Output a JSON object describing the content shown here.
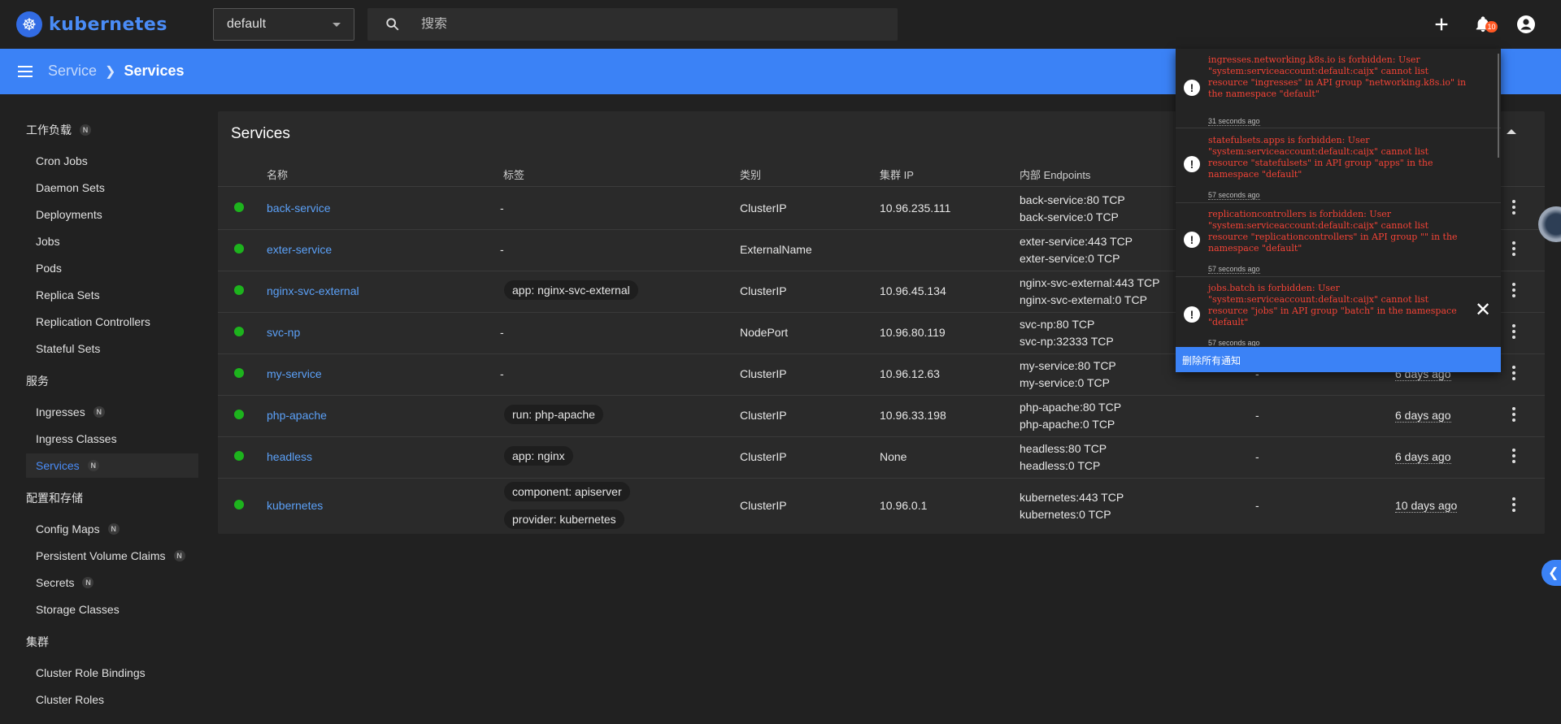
{
  "app": {
    "name": "kubernetes"
  },
  "namespace": {
    "selected": "default"
  },
  "search": {
    "placeholder": "搜索"
  },
  "notifications": {
    "count": "10",
    "clear_label": "删除所有通知",
    "items": [
      {
        "message": "ingresses.networking.k8s.io is forbidden: User \"system:serviceaccount:default:caijx\" cannot list resource \"ingresses\" in API group \"networking.k8s.io\" in the namespace \"default\"",
        "time": "31 seconds ago"
      },
      {
        "message": "statefulsets.apps is forbidden: User \"system:serviceaccount:default:caijx\" cannot list resource \"statefulsets\" in API group \"apps\" in the namespace \"default\"",
        "time": "57 seconds ago"
      },
      {
        "message": "replicationcontrollers is forbidden: User \"system:serviceaccount:default:caijx\" cannot list resource \"replicationcontrollers\" in API group \"\" in the namespace \"default\"",
        "time": "57 seconds ago"
      },
      {
        "message": "jobs.batch is forbidden: User \"system:serviceaccount:default:caijx\" cannot list resource \"jobs\" in API group \"batch\" in the namespace \"default\"",
        "time": "57 seconds ago"
      }
    ]
  },
  "breadcrumb": {
    "parent": "Service",
    "current": "Services"
  },
  "sidebar": {
    "workloads": {
      "title": "工作负载",
      "badge": "N",
      "items": [
        "Cron Jobs",
        "Daemon Sets",
        "Deployments",
        "Jobs",
        "Pods",
        "Replica Sets",
        "Replication Controllers",
        "Stateful Sets"
      ]
    },
    "service": {
      "title": "服务",
      "items": [
        {
          "label": "Ingresses",
          "badge": "N"
        },
        {
          "label": "Ingress Classes"
        },
        {
          "label": "Services",
          "badge": "N",
          "active": true
        }
      ]
    },
    "config": {
      "title": "配置和存储",
      "items": [
        {
          "label": "Config Maps",
          "badge": "N"
        },
        {
          "label": "Persistent Volume Claims",
          "badge": "N"
        },
        {
          "label": "Secrets",
          "badge": "N"
        },
        {
          "label": "Storage Classes"
        }
      ]
    },
    "cluster": {
      "title": "集群",
      "items": [
        "Cluster Role Bindings",
        "Cluster Roles"
      ]
    }
  },
  "table": {
    "title": "Services",
    "columns": {
      "name": "名称",
      "labels": "标签",
      "type": "类别",
      "cluster_ip": "集群 IP",
      "endpoints": "内部 Endpoints"
    },
    "rows": [
      {
        "name": "back-service",
        "labels": [
          "-"
        ],
        "type": "ClusterIP",
        "cluster_ip": "10.96.235.111",
        "endpoints": [
          "back-service:80 TCP",
          "back-service:0 TCP"
        ],
        "external": "",
        "age": ""
      },
      {
        "name": "exter-service",
        "labels": [
          "-"
        ],
        "type": "ExternalName",
        "cluster_ip": "",
        "endpoints": [
          "exter-service:443 TCP",
          "exter-service:0 TCP"
        ],
        "external": "",
        "age": ""
      },
      {
        "name": "nginx-svc-external",
        "labels": [
          "app: nginx-svc-external"
        ],
        "type": "ClusterIP",
        "cluster_ip": "10.96.45.134",
        "endpoints": [
          "nginx-svc-external:443 TCP",
          "nginx-svc-external:0 TCP"
        ],
        "external": "",
        "age": ""
      },
      {
        "name": "svc-np",
        "labels": [
          "-"
        ],
        "type": "NodePort",
        "cluster_ip": "10.96.80.119",
        "endpoints": [
          "svc-np:80 TCP",
          "svc-np:32333 TCP"
        ],
        "external": "",
        "age": ""
      },
      {
        "name": "my-service",
        "labels": [
          "-"
        ],
        "type": "ClusterIP",
        "cluster_ip": "10.96.12.63",
        "endpoints": [
          "my-service:80 TCP",
          "my-service:0 TCP"
        ],
        "external": "-",
        "age": "6 days ago"
      },
      {
        "name": "php-apache",
        "labels": [
          "run: php-apache"
        ],
        "type": "ClusterIP",
        "cluster_ip": "10.96.33.198",
        "endpoints": [
          "php-apache:80 TCP",
          "php-apache:0 TCP"
        ],
        "external": "-",
        "age": "6 days ago"
      },
      {
        "name": "headless",
        "labels": [
          "app: nginx"
        ],
        "type": "ClusterIP",
        "cluster_ip": "None",
        "endpoints": [
          "headless:80 TCP",
          "headless:0 TCP"
        ],
        "external": "-",
        "age": "6 days ago"
      },
      {
        "name": "kubernetes",
        "labels": [
          "component: apiserver",
          "provider: kubernetes"
        ],
        "type": "ClusterIP",
        "cluster_ip": "10.96.0.1",
        "endpoints": [
          "kubernetes:443 TCP",
          "kubernetes:0 TCP"
        ],
        "external": "-",
        "age": "10 days ago"
      }
    ]
  },
  "colors": {
    "accent": "#3b82f6",
    "link": "#5ba0f7",
    "status_ok": "#1db31d",
    "error_text": "#f44336"
  }
}
